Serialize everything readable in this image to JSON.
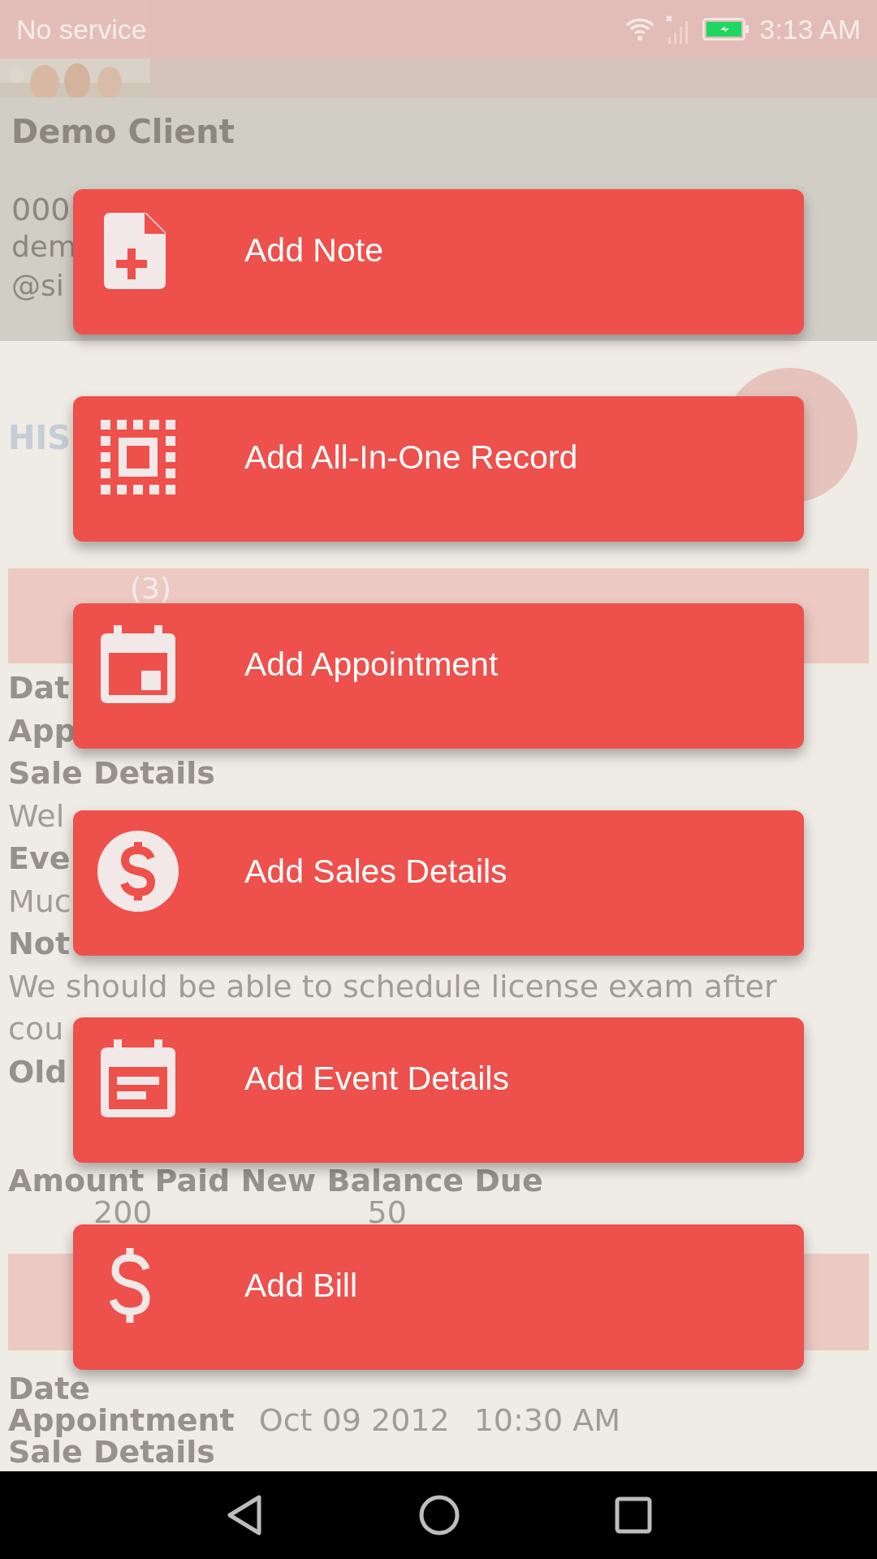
{
  "status_bar": {
    "carrier": "No service",
    "time": "3:13 AM"
  },
  "client": {
    "name": "Demo Client",
    "phone": "000",
    "email_lines": [
      "dem",
      "@si"
    ]
  },
  "section_title": "HIS",
  "tab_badge": "(3)",
  "record_1": [
    {
      "kind": "label",
      "text": "Dat"
    },
    {
      "kind": "label",
      "text": "App"
    },
    {
      "kind": "label",
      "text": "Sale Details"
    },
    {
      "kind": "text",
      "text": "Wel"
    },
    {
      "kind": "label",
      "text": "Eve"
    },
    {
      "kind": "text",
      "text": "Muc"
    },
    {
      "kind": "label",
      "text": "Not"
    },
    {
      "kind": "text",
      "text": "We should be able to schedule license exam after"
    },
    {
      "kind": "text",
      "text": "cou"
    },
    {
      "kind": "label",
      "text": "Old"
    }
  ],
  "amounts": {
    "header": "Amount Paid  New Balance Due",
    "values": [
      "200",
      "50"
    ]
  },
  "record_2": {
    "date_label": "Date",
    "appointment_label": "Appointment",
    "appointment_date": "Oct 09 2012",
    "appointment_time": "10:30 AM",
    "sale_label": "Sale Details"
  },
  "menu": [
    {
      "kind": "note",
      "label": "Add Note"
    },
    {
      "kind": "all_in_one",
      "label": "Add All-In-One Record"
    },
    {
      "kind": "appointment",
      "label": "Add Appointment"
    },
    {
      "kind": "sales",
      "label": "Add Sales Details"
    },
    {
      "kind": "event",
      "label": "Add Event Details"
    },
    {
      "kind": "bill",
      "label": "Add Bill"
    }
  ]
}
